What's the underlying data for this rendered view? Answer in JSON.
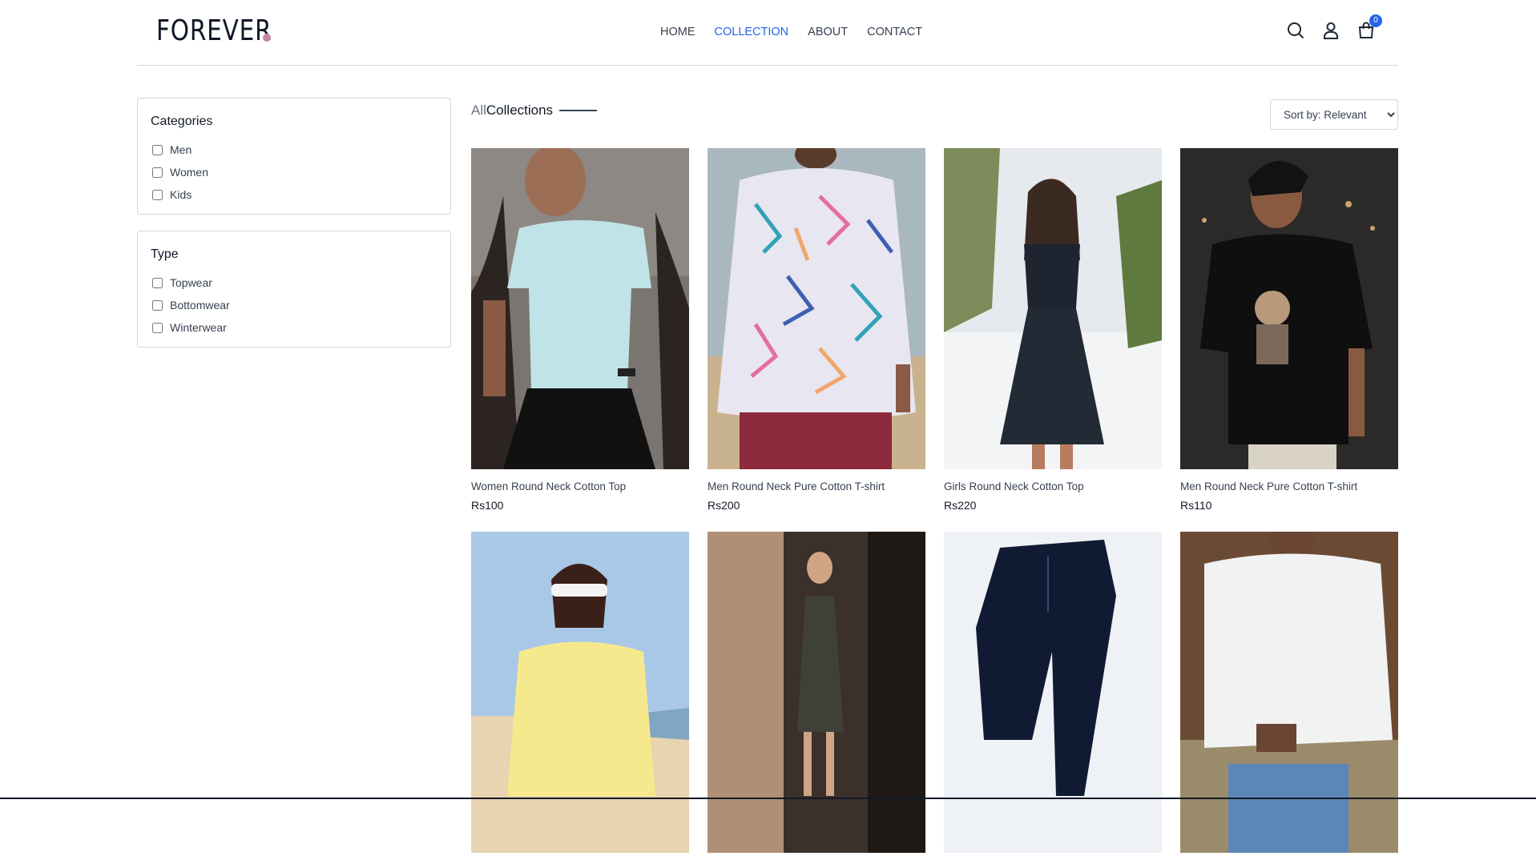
{
  "header": {
    "logo": "FOREVER",
    "nav": [
      {
        "label": "HOME",
        "active": false
      },
      {
        "label": "COLLECTION",
        "active": true
      },
      {
        "label": "ABOUT",
        "active": false
      },
      {
        "label": "CONTACT",
        "active": false
      }
    ],
    "icons": [
      "search-icon",
      "profile-icon",
      "cart-icon"
    ],
    "cart_count": "0",
    "accent_color": "#2563eb"
  },
  "filters": {
    "categories": {
      "title": "Categories",
      "items": [
        "Men",
        "Women",
        "Kids"
      ]
    },
    "type": {
      "title": "Type",
      "items": [
        "Topwear",
        "Bottomwear",
        "Winterwear"
      ]
    }
  },
  "collection": {
    "title_light": "All",
    "title_bold": "Collections",
    "sort_selected": "Sort by: Relevant"
  },
  "products": [
    {
      "name": "Women Round Neck Cotton Top",
      "price": "Rs100"
    },
    {
      "name": "Men Round Neck Pure Cotton T-shirt",
      "price": "Rs200"
    },
    {
      "name": "Girls Round Neck Cotton Top",
      "price": "Rs220"
    },
    {
      "name": "Men Round Neck Pure Cotton T-shirt",
      "price": "Rs110"
    },
    {
      "name": "",
      "price": ""
    },
    {
      "name": "",
      "price": ""
    },
    {
      "name": "",
      "price": ""
    },
    {
      "name": "",
      "price": ""
    }
  ]
}
